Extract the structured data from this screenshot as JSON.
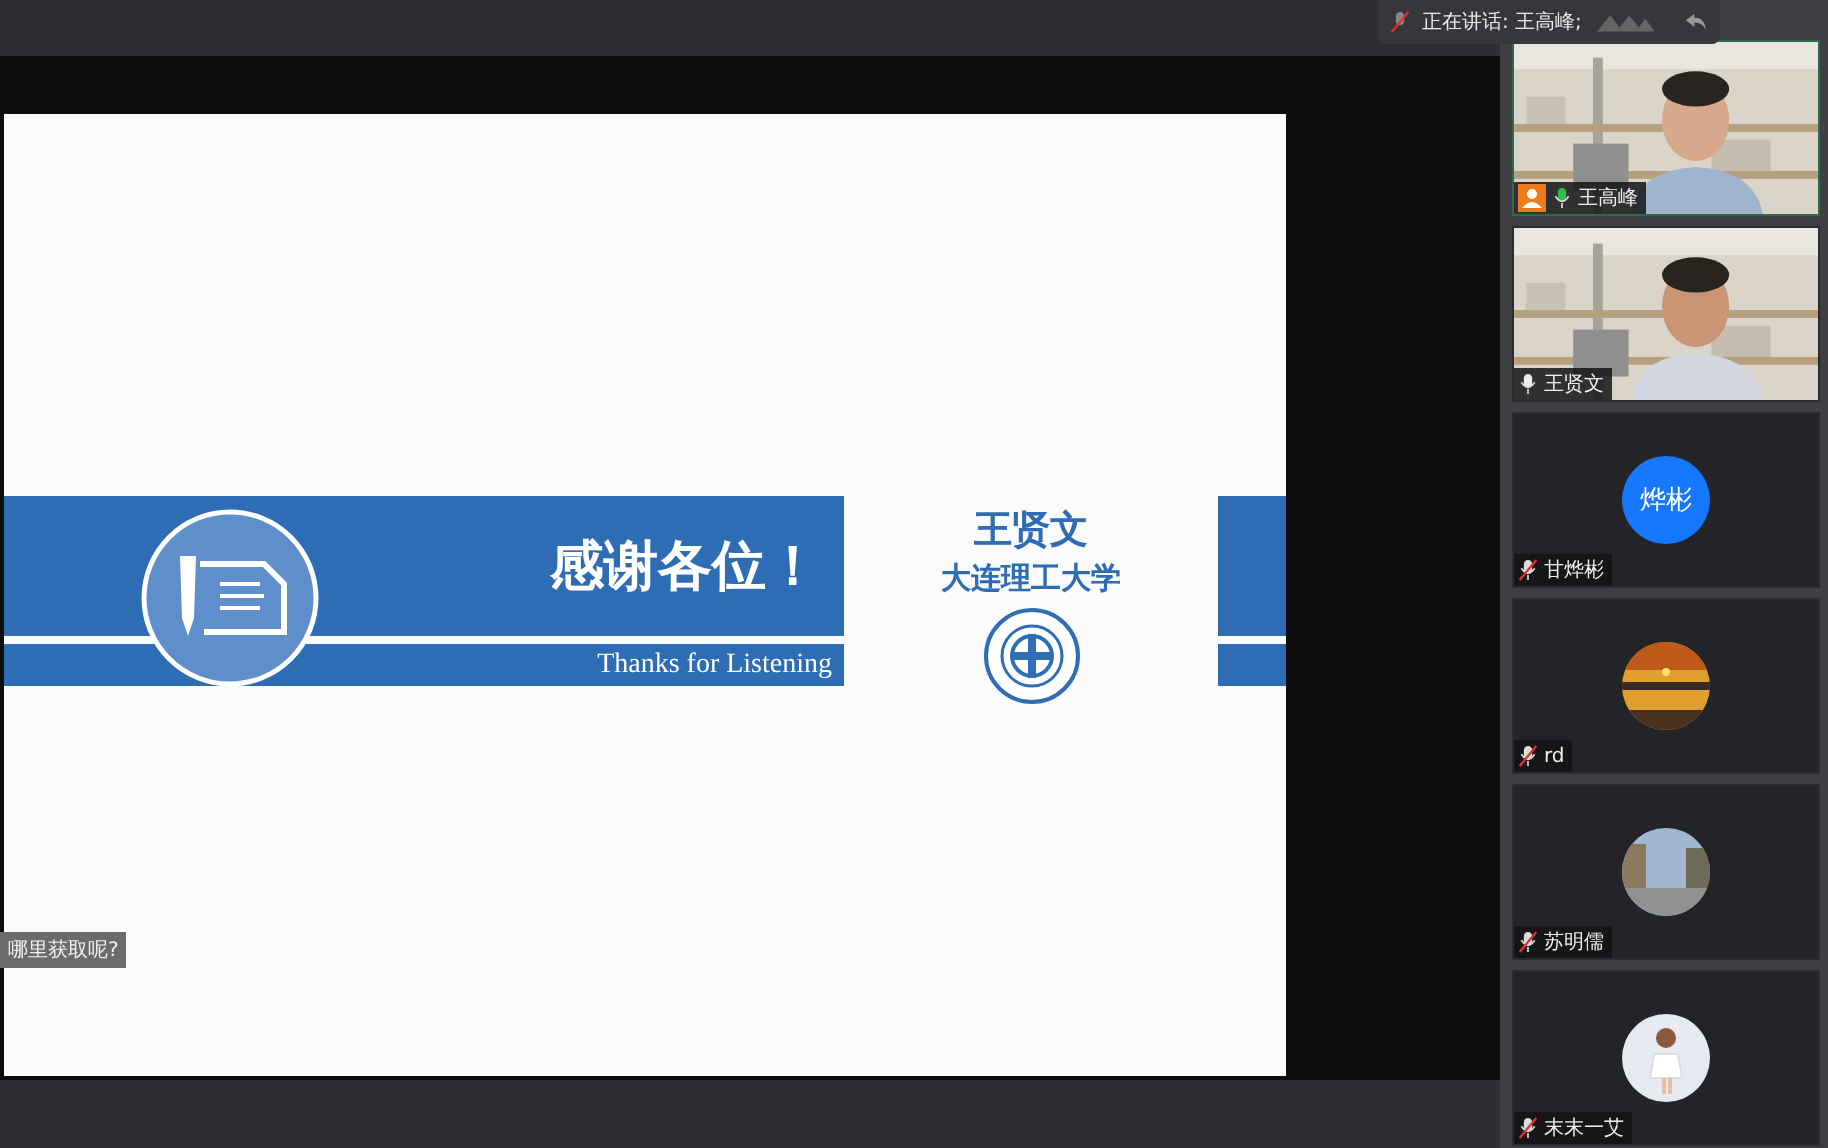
{
  "speaking_indicator": {
    "label": "正在讲话: 王高峰;"
  },
  "slide": {
    "title": "感谢各位！",
    "subtitle": "Thanks for Listening",
    "presenter": "王贤文",
    "institution": "大连理工大学"
  },
  "caption": "哪里获取呢?",
  "participants": [
    {
      "name": "王高峰",
      "kind": "video",
      "muted": false,
      "host": true,
      "speaking": true
    },
    {
      "name": "王贤文",
      "kind": "video",
      "muted": false,
      "host": false,
      "speaking": false
    },
    {
      "name": "甘烨彬",
      "kind": "initials",
      "initials": "烨彬",
      "muted": true,
      "host": false,
      "speaking": false
    },
    {
      "name": "rd",
      "kind": "picture",
      "muted": true,
      "host": false,
      "speaking": false
    },
    {
      "name": "苏明儒",
      "kind": "picture",
      "muted": true,
      "host": false,
      "speaking": false
    },
    {
      "name": "末末一艾",
      "kind": "picture",
      "muted": true,
      "host": false,
      "speaking": false
    }
  ]
}
